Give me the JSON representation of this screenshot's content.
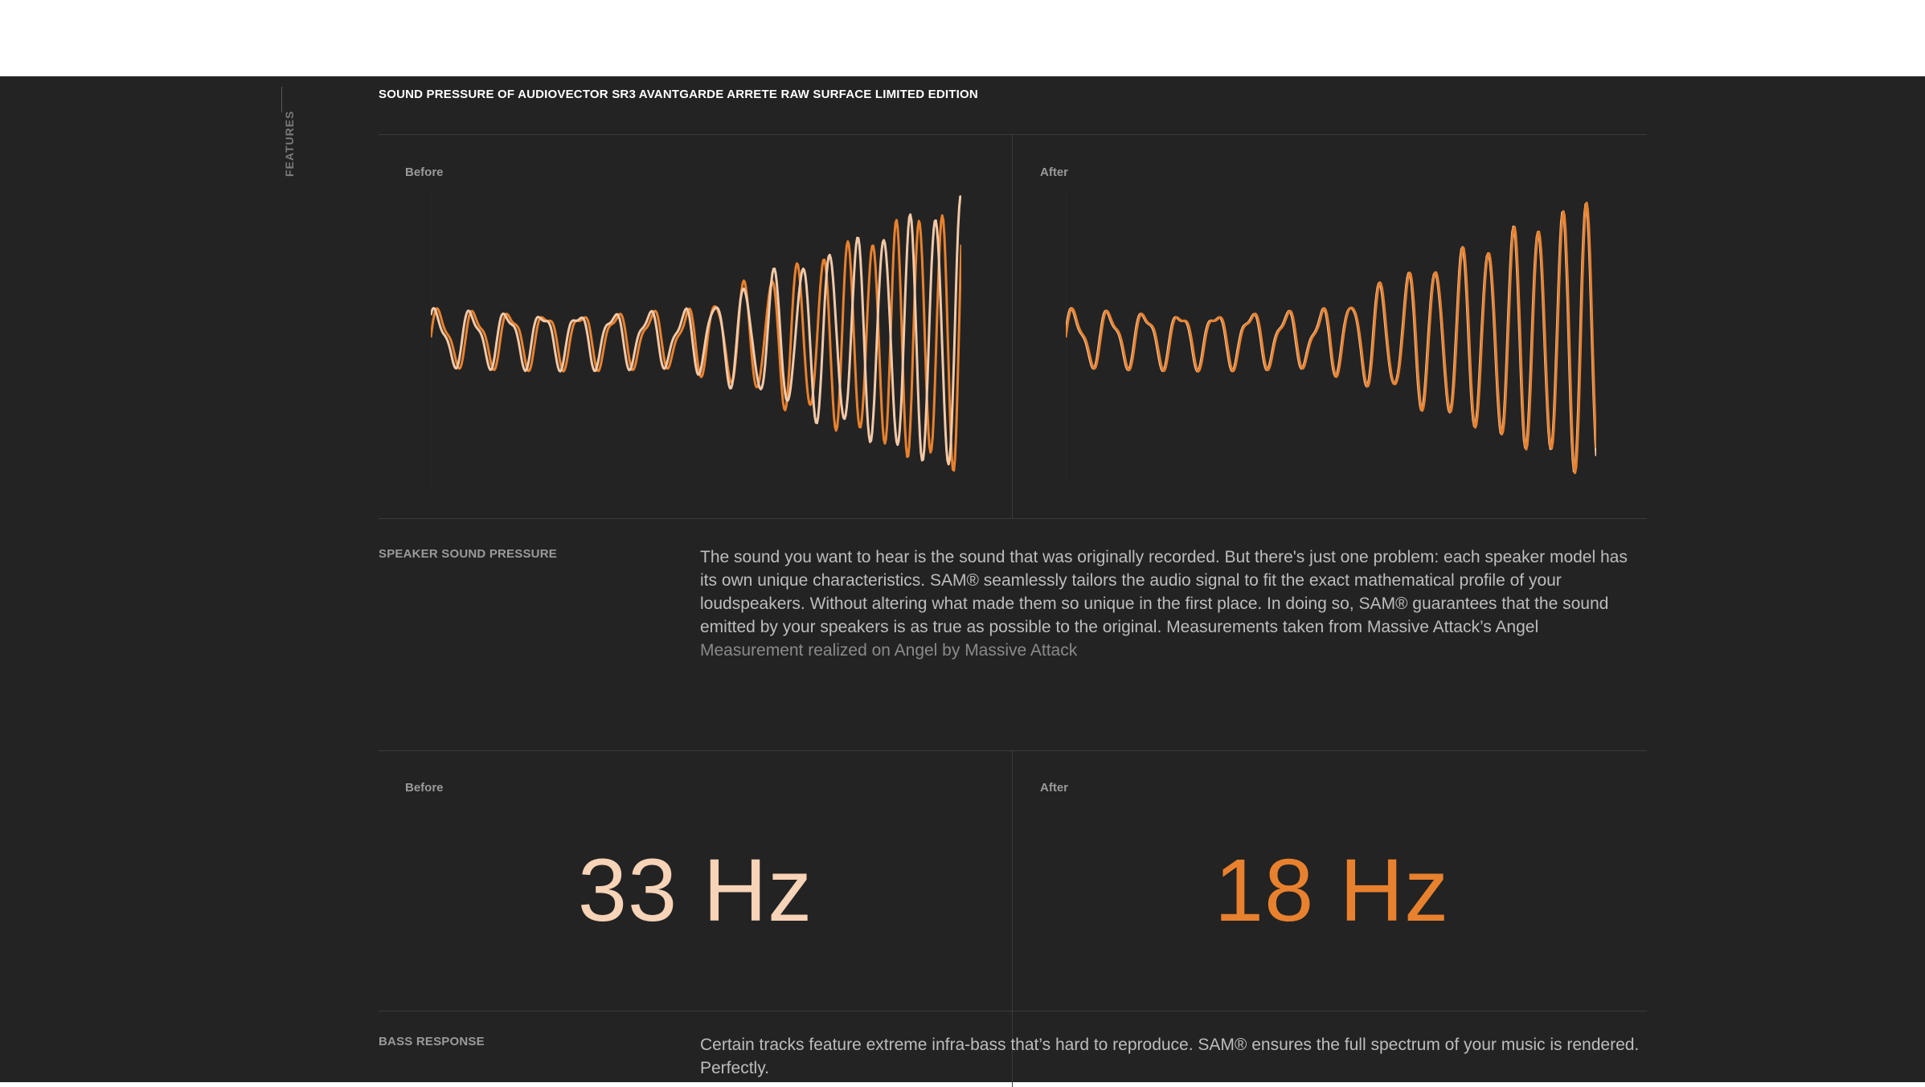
{
  "section": {
    "side_label": "FEATURES",
    "title": "SOUND PRESSURE OF AUDIOVECTOR SR3 AVANTGARDE ARRETE RAW SURFACE LIMITED EDITION"
  },
  "pressure": {
    "before_label": "Before",
    "after_label": "After",
    "row_label": "SPEAKER SOUND PRESSURE",
    "description": "The sound you want to hear is the sound that was originally recorded. But there's just one problem: each speaker model has its own unique characteristics. SAM® seamlessly tailors the audio signal to fit the exact mathematical profile of your loudspeakers. Without altering what made them so unique in the first place. In doing so, SAM® guarantees that the sound emitted by your speakers is as true as possible to the original. Measurements taken from Massive Attack’s Angel",
    "caption": "Measurement realized on Angel by Massive Attack"
  },
  "bass": {
    "before_label": "Before",
    "after_label": "After",
    "before_value": "33 Hz",
    "after_value": "18 Hz",
    "row_label": "BASS RESPONSE",
    "description": "Certain tracks feature extreme infra-bass that’s hard to reproduce. SAM® ensures the full spectrum of your music is rendered. Perfectly."
  },
  "colors": {
    "original_wave": "#f2c9a8",
    "processed_wave": "#e8812e",
    "before_value": "#f7d3b7",
    "after_value": "#e8812e"
  }
}
